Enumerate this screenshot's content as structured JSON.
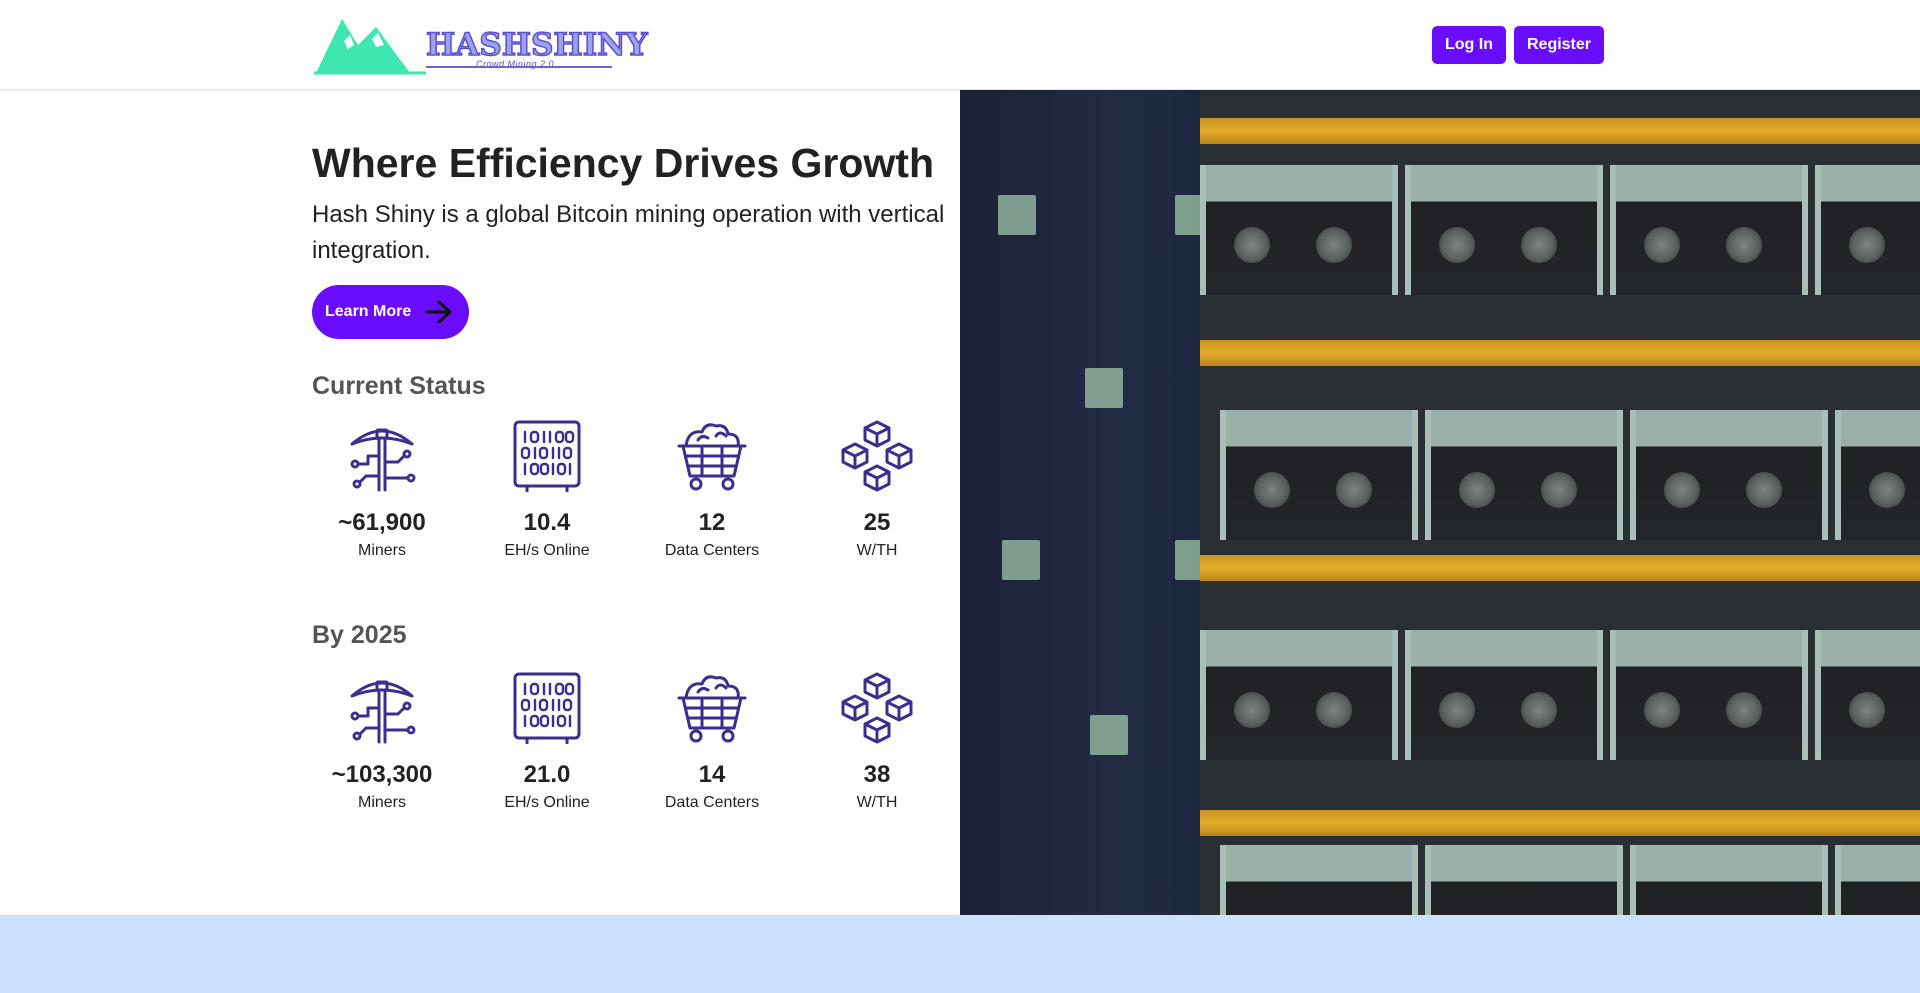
{
  "header": {
    "logo_text": "HASHSHINY",
    "logo_tagline": "Crowd Mining 2.0",
    "login_label": "Log In",
    "register_label": "Register"
  },
  "hero": {
    "title": "Where Efficiency Drives Growth",
    "description": "Hash Shiny is a global Bitcoin mining operation with vertical integration.",
    "cta_label": "Learn More"
  },
  "current_status": {
    "title": "Current Status",
    "stats": [
      {
        "icon": "pickaxe-icon",
        "value": "~61,900",
        "label": "Miners"
      },
      {
        "icon": "binary-chip-icon",
        "value": "10.4",
        "label": "EH/s Online"
      },
      {
        "icon": "mining-cart-icon",
        "value": "12",
        "label": "Data Centers"
      },
      {
        "icon": "blocks-icon",
        "value": "25",
        "label": "W/TH"
      }
    ]
  },
  "by_2025": {
    "title": "By 2025",
    "stats": [
      {
        "icon": "pickaxe-icon",
        "value": "~103,300",
        "label": "Miners"
      },
      {
        "icon": "binary-chip-icon",
        "value": "21.0",
        "label": "EH/s Online"
      },
      {
        "icon": "mining-cart-icon",
        "value": "14",
        "label": "Data Centers"
      },
      {
        "icon": "blocks-icon",
        "value": "38",
        "label": "W/TH"
      }
    ]
  },
  "colors": {
    "accent": "#6a0dff",
    "icon": "#3b2e8e",
    "footer_band": "#cde0fd",
    "logo_mountain": "#3fe6b0"
  }
}
